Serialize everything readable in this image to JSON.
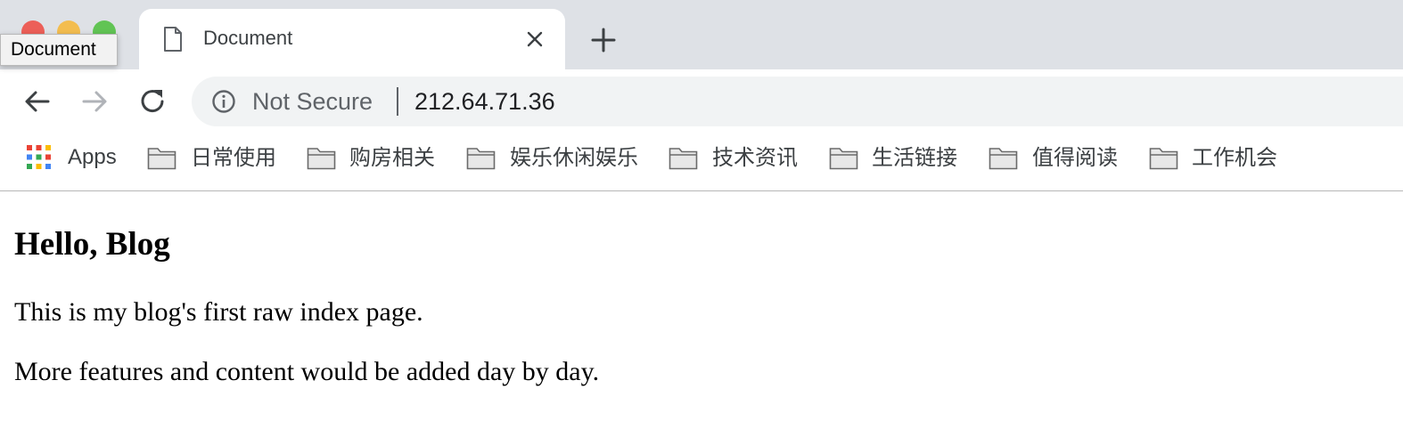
{
  "window": {
    "tooltip": "Document"
  },
  "tab": {
    "title": "Document",
    "icon": "document-icon"
  },
  "toolbar": {
    "security_label": "Not Secure",
    "url": "212.64.71.36"
  },
  "bookmarks": {
    "apps_label": "Apps",
    "items": [
      {
        "label": "日常使用",
        "icon": "folder-icon"
      },
      {
        "label": "购房相关",
        "icon": "folder-icon"
      },
      {
        "label": "娱乐休闲娱乐",
        "icon": "folder-icon"
      },
      {
        "label": "技术资讯",
        "icon": "folder-icon"
      },
      {
        "label": "生活链接",
        "icon": "folder-icon"
      },
      {
        "label": "值得阅读",
        "icon": "folder-icon"
      },
      {
        "label": "工作机会",
        "icon": "folder-icon"
      }
    ]
  },
  "page": {
    "heading": "Hello, Blog",
    "paragraphs": [
      "This is my blog's first raw index page.",
      "More features and content would be added day by day."
    ]
  },
  "colors": {
    "tabstrip_bg": "#dee1e6",
    "omnibox_bg": "#f1f3f4",
    "close": "#ec5f58",
    "minimize": "#f3bd4f",
    "maximize": "#61c454"
  }
}
